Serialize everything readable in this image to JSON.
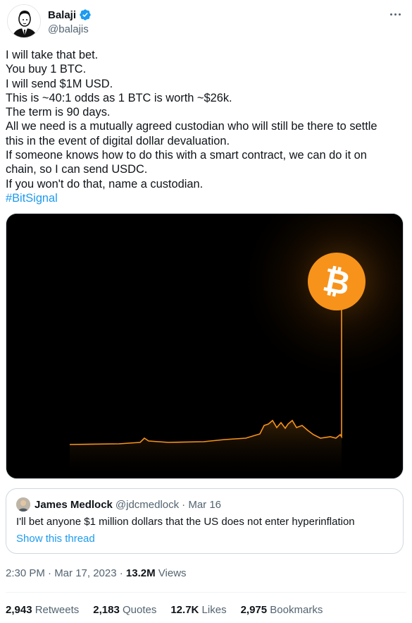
{
  "author": {
    "name": "Balaji",
    "handle": "@balajis"
  },
  "tweet": {
    "lines": [
      "I will take that bet.",
      "You buy 1 BTC.",
      "I will send $1M USD.",
      "This is ~40:1 odds as 1 BTC is worth ~$26k.",
      "The term is 90 days.",
      "All we need is a mutually agreed custodian who will still be there to settle",
      "this in the event of digital dollar devaluation.",
      "If someone knows how to do this with a smart contract, we can do it on",
      "chain, so I can send USDC.",
      "If you won't do that, name a custodian."
    ],
    "hashtag": "#BitSignal"
  },
  "media": {
    "description_icon": "bitcoin-icon",
    "accent_color": "#f7931a"
  },
  "quote": {
    "name": "James Medlock",
    "handle": "@jdcmedlock",
    "date": "· Mar 16",
    "text": "I'll bet anyone $1 million dollars that the US does not enter hyperinflation",
    "show_thread": "Show this thread"
  },
  "meta": {
    "time_date": "2:30 PM · Mar 17, 2023 · ",
    "views_count": "13.2M",
    "views_label": " Views"
  },
  "stats": {
    "retweets_count": "2,943",
    "retweets_label": "Retweets",
    "quotes_count": "2,183",
    "quotes_label": "Quotes",
    "likes_count": "12.7K",
    "likes_label": "Likes",
    "bookmarks_count": "2,975",
    "bookmarks_label": "Bookmarks"
  }
}
